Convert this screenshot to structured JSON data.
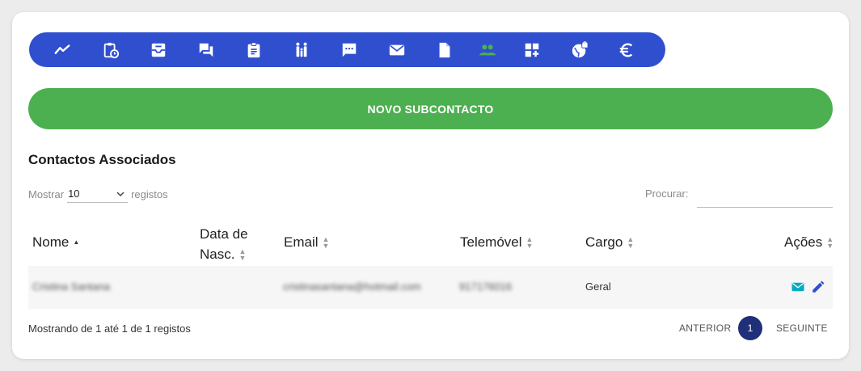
{
  "toolbar": {
    "icons": [
      "trend-icon",
      "clipboard-clock-icon",
      "inbox-icon",
      "forum-icon",
      "assignment-icon",
      "family-icon",
      "chat-icon",
      "mail-icon",
      "file-icon",
      "people-icon",
      "dashboard-add-icon",
      "public-lock-icon",
      "euro-icon"
    ],
    "active_icon": "people-icon",
    "accent": "#2f4fcf",
    "active_color": "#4caf50"
  },
  "new_button": {
    "label": "NOVO SUBCONTACTO",
    "color": "#4caf50"
  },
  "section": {
    "title": "Contactos Associados"
  },
  "length": {
    "prefix": "Mostrar",
    "value": "10",
    "suffix": "registos"
  },
  "search": {
    "label": "Procurar:",
    "value": ""
  },
  "table": {
    "headers": {
      "nome": "Nome",
      "data_line1": "Data de",
      "data_line2": "Nasc.",
      "email": "Email",
      "telemovel": "Telemóvel",
      "cargo": "Cargo",
      "acoes": "Ações"
    },
    "rows": [
      {
        "nome": "Cristina Santana",
        "data_nasc": "",
        "email": "cristinasantana@hotmail.com",
        "telemovel": "917176016",
        "cargo": "Geral"
      }
    ]
  },
  "footer": {
    "info": "Mostrando de 1 até 1 de 1 registos",
    "previous": "ANTERIOR",
    "page": "1",
    "next": "SEGUINTE"
  }
}
